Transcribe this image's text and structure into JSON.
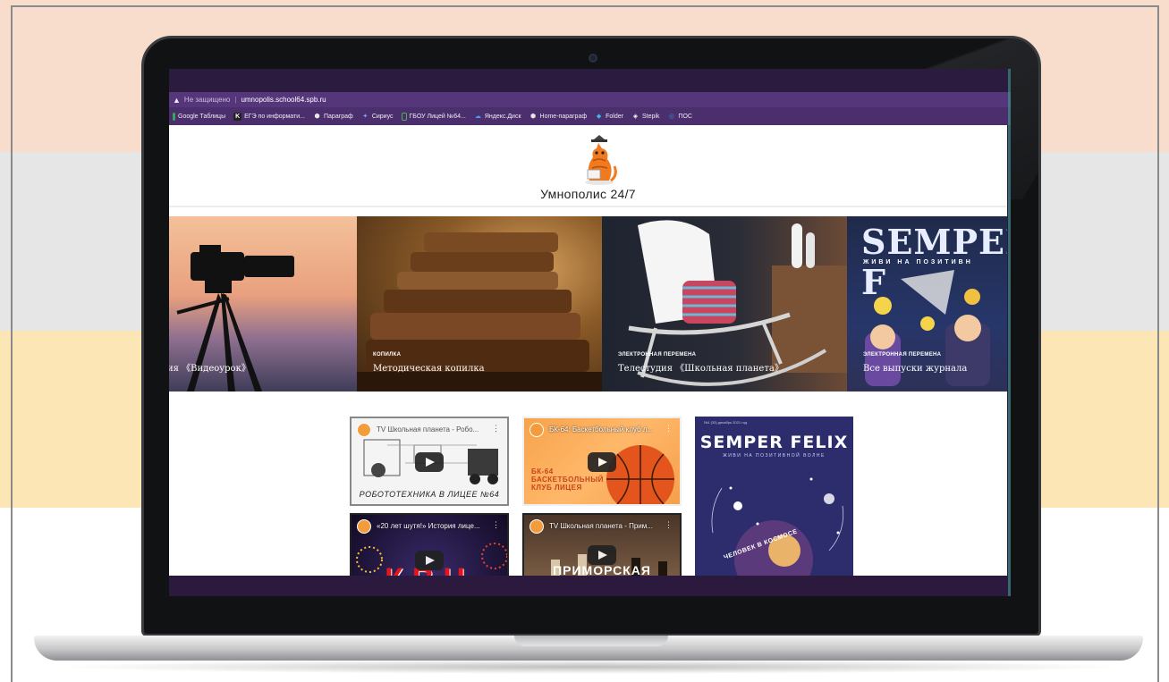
{
  "browser": {
    "insecure_label": "Не защищено",
    "url": "umnopolis.school64.spb.ru",
    "bookmarks": [
      {
        "label": "Google Таблицы",
        "icon": "google-sheets-icon",
        "color": "#34a853"
      },
      {
        "label": "ЕГЭ по информати...",
        "icon": "k-letter-icon",
        "color": "#222222"
      },
      {
        "label": "Параграф",
        "icon": "hexagon-icon",
        "color": "#e8e8e8"
      },
      {
        "label": "Сириус",
        "icon": "sirius-icon",
        "color": "#7a8cff"
      },
      {
        "label": "ГБОУ Лицей №64...",
        "icon": "page-icon",
        "color": "#4caf50"
      },
      {
        "label": "Яндекс.Диск",
        "icon": "cloud-icon",
        "color": "#4d9cff"
      },
      {
        "label": "Home-параграф",
        "icon": "hexagon-icon",
        "color": "#e8e8e8"
      },
      {
        "label": "Folder",
        "icon": "folder-icon",
        "color": "#3fb6e8"
      },
      {
        "label": "Stepik",
        "icon": "stepik-icon",
        "color": "#ffffff"
      },
      {
        "label": "ПОС",
        "icon": "pos-icon",
        "color": "#3a8dde"
      }
    ]
  },
  "site": {
    "title": "Умнополис 24/7",
    "logo": "cat-mascot-logo"
  },
  "slides": [
    {
      "category": "",
      "title": "ия 《Видеоурок》"
    },
    {
      "category": "КОПИЛКА",
      "title": "Методическая копилка"
    },
    {
      "category": "ЭЛЕКТРОННАЯ ПЕРЕМЕНА",
      "title": "Телестудия 《Школьная планета》"
    },
    {
      "category": "ЭЛЕКТРОННАЯ ПЕРЕМЕНА",
      "title": "Все выпуски журнала",
      "overlay": "SEMPER F",
      "overlay_sub": "ЖИВИ НА ПОЗИТИВН"
    }
  ],
  "videos": [
    {
      "title": "TV Школьная планета - Робо...",
      "caption": "РОБОТОТЕХНИКА В ЛИЦЕЕ №64"
    },
    {
      "title": "БК-64: Баскетбольный клуб л...",
      "caption": "БК-64 БАСКЕТБОЛЬНЫЙ КЛУБ ЛИЦЕЯ"
    },
    {
      "title": "«20 лет шутя!» История лице...",
      "caption": "КВН"
    },
    {
      "title": "TV Школьная планета - Прим...",
      "caption": "ПРИМОРСКАЯ"
    }
  ],
  "magazine": {
    "title": "SEMPER FELIX",
    "subtitle": "ЖИВИ НА ПОЗИТИВНОЙ ВОЛНЕ",
    "issue": "№1 (33) декабрь 2021 год",
    "side_text": "ЧЕЛОВЕК В КОСМОСЕ"
  },
  "colors": {
    "browser_bar": "#56367a",
    "bookmarks_bar": "#4b2e6c",
    "screen_frame": "#2b1b3e"
  }
}
